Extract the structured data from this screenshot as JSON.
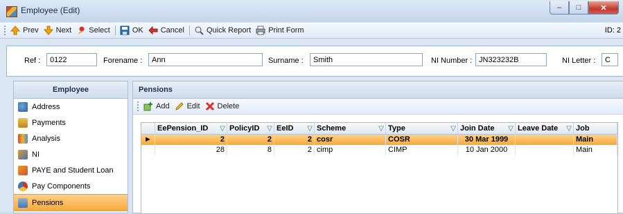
{
  "window": {
    "title": "Employee (Edit)"
  },
  "toolbar": {
    "prev": "Prev",
    "next": "Next",
    "select": "Select",
    "ok": "OK",
    "cancel": "Cancel",
    "quick_report": "Quick Report",
    "print_form": "Print Form",
    "id_label": "ID: 2"
  },
  "fields": {
    "ref_label": "Ref :",
    "ref_value": "0122",
    "forename_label": "Forename :",
    "forename_value": "Ann",
    "surname_label": "Surname :",
    "surname_value": "Smith",
    "ni_number_label": "NI Number :",
    "ni_number_value": "JN323232B",
    "ni_letter_label": "NI Letter :",
    "ni_letter_value": "C"
  },
  "sidebar": {
    "title": "Employee",
    "items": [
      {
        "label": "Address",
        "icon": "address-icon"
      },
      {
        "label": "Payments",
        "icon": "payments-icon"
      },
      {
        "label": "Analysis",
        "icon": "analysis-icon"
      },
      {
        "label": "NI",
        "icon": "ni-icon"
      },
      {
        "label": "PAYE and Student Loan",
        "icon": "paye-icon"
      },
      {
        "label": "Pay Components",
        "icon": "pay-components-icon"
      },
      {
        "label": "Pensions",
        "icon": "pensions-icon",
        "active": true
      }
    ]
  },
  "main": {
    "title": "Pensions",
    "actions": {
      "add": "Add",
      "edit": "Edit",
      "delete": "Delete"
    },
    "columns": [
      "EePension_ID",
      "PolicyID",
      "EeID",
      "Scheme",
      "Type",
      "Join Date",
      "Leave Date",
      "Job"
    ],
    "rows": [
      {
        "id": "2",
        "policy": "2",
        "ee": "2",
        "scheme": "cosr",
        "type": "COSR",
        "join": "30 Mar 1999",
        "leave": "",
        "job": "Main"
      },
      {
        "id": "28",
        "policy": "8",
        "ee": "2",
        "scheme": "cimp",
        "type": "CIMP",
        "join": "10 Jan 2000",
        "leave": "",
        "job": "Main"
      }
    ]
  },
  "colors": {
    "selection": "#f8a93a",
    "header_bg": "#cfdcec"
  }
}
